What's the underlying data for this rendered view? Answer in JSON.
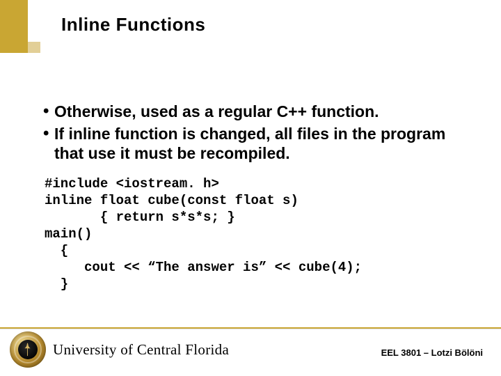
{
  "title": "Inline Functions",
  "bullets": [
    "Otherwise, used as a regular C++ function.",
    "If inline function is changed, all files in the program that use it must be recompiled."
  ],
  "code": "#include <iostream. h>\ninline float cube(const float s)\n       { return s*s*s; }\nmain()\n  {\n     cout << “The answer is” << cube(4);\n  }",
  "footer": {
    "university": "University of Central Florida",
    "credit": "EEL 3801 – Lotzi Bölöni"
  },
  "colors": {
    "accent": "#c9a633"
  }
}
